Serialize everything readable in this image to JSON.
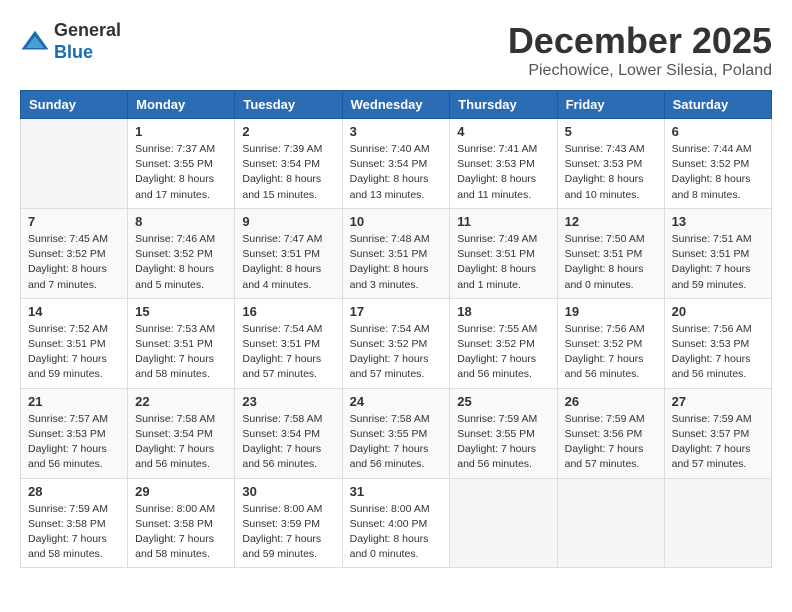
{
  "logo": {
    "general": "General",
    "blue": "Blue"
  },
  "title": "December 2025",
  "subtitle": "Piechowice, Lower Silesia, Poland",
  "weekdays": [
    "Sunday",
    "Monday",
    "Tuesday",
    "Wednesday",
    "Thursday",
    "Friday",
    "Saturday"
  ],
  "weeks": [
    [
      {
        "day": "",
        "info": ""
      },
      {
        "day": "1",
        "info": "Sunrise: 7:37 AM\nSunset: 3:55 PM\nDaylight: 8 hours\nand 17 minutes."
      },
      {
        "day": "2",
        "info": "Sunrise: 7:39 AM\nSunset: 3:54 PM\nDaylight: 8 hours\nand 15 minutes."
      },
      {
        "day": "3",
        "info": "Sunrise: 7:40 AM\nSunset: 3:54 PM\nDaylight: 8 hours\nand 13 minutes."
      },
      {
        "day": "4",
        "info": "Sunrise: 7:41 AM\nSunset: 3:53 PM\nDaylight: 8 hours\nand 11 minutes."
      },
      {
        "day": "5",
        "info": "Sunrise: 7:43 AM\nSunset: 3:53 PM\nDaylight: 8 hours\nand 10 minutes."
      },
      {
        "day": "6",
        "info": "Sunrise: 7:44 AM\nSunset: 3:52 PM\nDaylight: 8 hours\nand 8 minutes."
      }
    ],
    [
      {
        "day": "7",
        "info": "Sunrise: 7:45 AM\nSunset: 3:52 PM\nDaylight: 8 hours\nand 7 minutes."
      },
      {
        "day": "8",
        "info": "Sunrise: 7:46 AM\nSunset: 3:52 PM\nDaylight: 8 hours\nand 5 minutes."
      },
      {
        "day": "9",
        "info": "Sunrise: 7:47 AM\nSunset: 3:51 PM\nDaylight: 8 hours\nand 4 minutes."
      },
      {
        "day": "10",
        "info": "Sunrise: 7:48 AM\nSunset: 3:51 PM\nDaylight: 8 hours\nand 3 minutes."
      },
      {
        "day": "11",
        "info": "Sunrise: 7:49 AM\nSunset: 3:51 PM\nDaylight: 8 hours\nand 1 minute."
      },
      {
        "day": "12",
        "info": "Sunrise: 7:50 AM\nSunset: 3:51 PM\nDaylight: 8 hours\nand 0 minutes."
      },
      {
        "day": "13",
        "info": "Sunrise: 7:51 AM\nSunset: 3:51 PM\nDaylight: 7 hours\nand 59 minutes."
      }
    ],
    [
      {
        "day": "14",
        "info": "Sunrise: 7:52 AM\nSunset: 3:51 PM\nDaylight: 7 hours\nand 59 minutes."
      },
      {
        "day": "15",
        "info": "Sunrise: 7:53 AM\nSunset: 3:51 PM\nDaylight: 7 hours\nand 58 minutes."
      },
      {
        "day": "16",
        "info": "Sunrise: 7:54 AM\nSunset: 3:51 PM\nDaylight: 7 hours\nand 57 minutes."
      },
      {
        "day": "17",
        "info": "Sunrise: 7:54 AM\nSunset: 3:52 PM\nDaylight: 7 hours\nand 57 minutes."
      },
      {
        "day": "18",
        "info": "Sunrise: 7:55 AM\nSunset: 3:52 PM\nDaylight: 7 hours\nand 56 minutes."
      },
      {
        "day": "19",
        "info": "Sunrise: 7:56 AM\nSunset: 3:52 PM\nDaylight: 7 hours\nand 56 minutes."
      },
      {
        "day": "20",
        "info": "Sunrise: 7:56 AM\nSunset: 3:53 PM\nDaylight: 7 hours\nand 56 minutes."
      }
    ],
    [
      {
        "day": "21",
        "info": "Sunrise: 7:57 AM\nSunset: 3:53 PM\nDaylight: 7 hours\nand 56 minutes."
      },
      {
        "day": "22",
        "info": "Sunrise: 7:58 AM\nSunset: 3:54 PM\nDaylight: 7 hours\nand 56 minutes."
      },
      {
        "day": "23",
        "info": "Sunrise: 7:58 AM\nSunset: 3:54 PM\nDaylight: 7 hours\nand 56 minutes."
      },
      {
        "day": "24",
        "info": "Sunrise: 7:58 AM\nSunset: 3:55 PM\nDaylight: 7 hours\nand 56 minutes."
      },
      {
        "day": "25",
        "info": "Sunrise: 7:59 AM\nSunset: 3:55 PM\nDaylight: 7 hours\nand 56 minutes."
      },
      {
        "day": "26",
        "info": "Sunrise: 7:59 AM\nSunset: 3:56 PM\nDaylight: 7 hours\nand 57 minutes."
      },
      {
        "day": "27",
        "info": "Sunrise: 7:59 AM\nSunset: 3:57 PM\nDaylight: 7 hours\nand 57 minutes."
      }
    ],
    [
      {
        "day": "28",
        "info": "Sunrise: 7:59 AM\nSunset: 3:58 PM\nDaylight: 7 hours\nand 58 minutes."
      },
      {
        "day": "29",
        "info": "Sunrise: 8:00 AM\nSunset: 3:58 PM\nDaylight: 7 hours\nand 58 minutes."
      },
      {
        "day": "30",
        "info": "Sunrise: 8:00 AM\nSunset: 3:59 PM\nDaylight: 7 hours\nand 59 minutes."
      },
      {
        "day": "31",
        "info": "Sunrise: 8:00 AM\nSunset: 4:00 PM\nDaylight: 8 hours\nand 0 minutes."
      },
      {
        "day": "",
        "info": ""
      },
      {
        "day": "",
        "info": ""
      },
      {
        "day": "",
        "info": ""
      }
    ]
  ]
}
